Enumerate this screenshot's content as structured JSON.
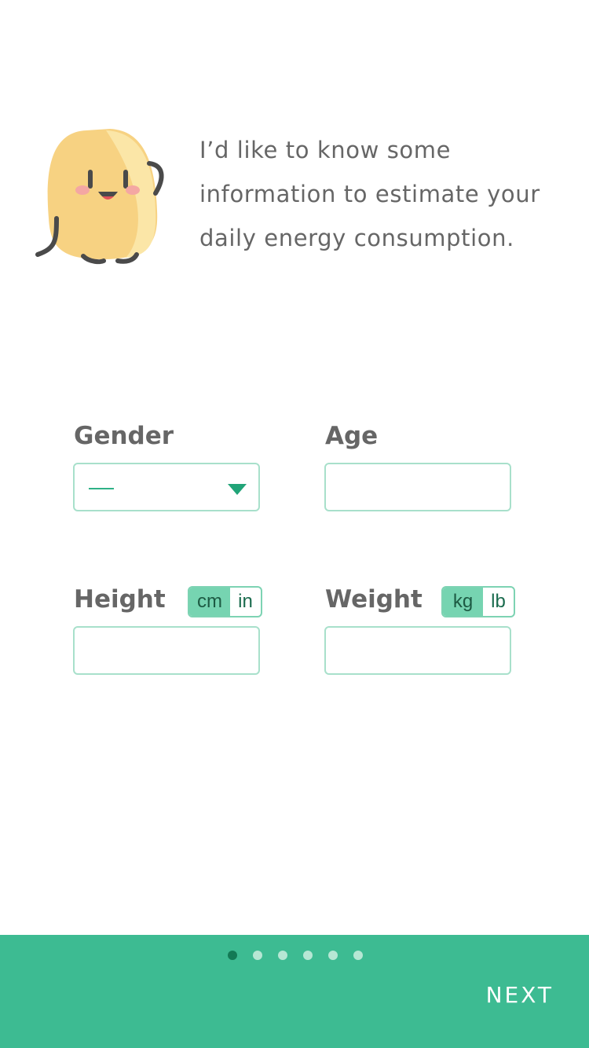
{
  "intro": {
    "line1": "I’d like to know some",
    "line2": "information to estimate your",
    "line3": "daily energy consumption."
  },
  "form": {
    "gender": {
      "label": "Gender",
      "value": "—",
      "icon": "caret-down-icon"
    },
    "age": {
      "label": "Age",
      "value": ""
    },
    "height": {
      "label": "Height",
      "units": [
        "cm",
        "in"
      ],
      "selected_unit": "cm",
      "value": ""
    },
    "weight": {
      "label": "Weight",
      "units": [
        "kg",
        "lb"
      ],
      "selected_unit": "kg",
      "value": ""
    }
  },
  "footer": {
    "pages": 6,
    "current_page": 1,
    "next_label": "NEXT"
  },
  "colors": {
    "accent": "#3dbb92",
    "active_dot": "#137a55",
    "input_border": "#a8e0cb"
  }
}
